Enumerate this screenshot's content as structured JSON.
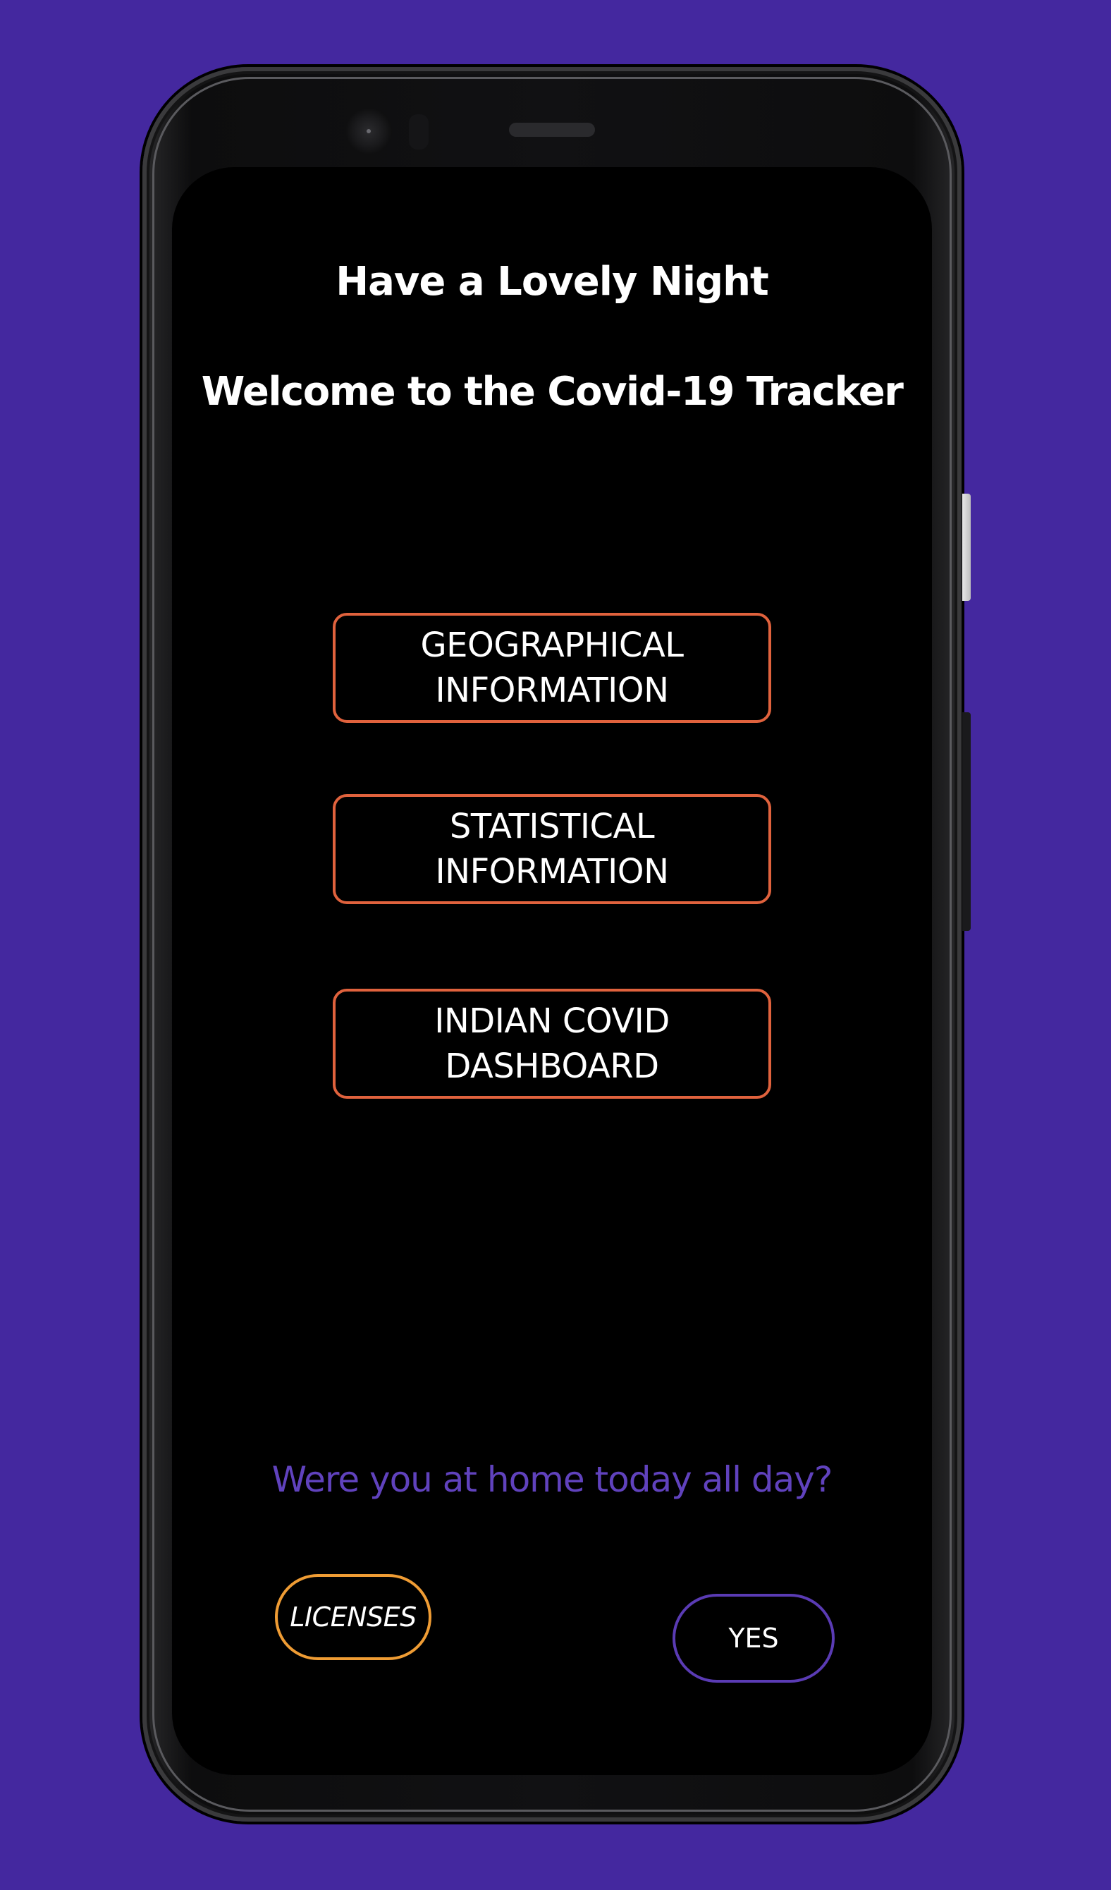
{
  "screen": {
    "greeting": "Have a Lovely Night",
    "welcome": "Welcome to the Covid-19 Tracker",
    "menu": {
      "geographical": "GEOGRAPHICAL\nINFORMATION",
      "statistical": "STATISTICAL\nINFORMATION",
      "dashboard": "INDIAN COVID\nDASHBOARD"
    },
    "question": "Were you at home today all day?",
    "licenses_label": "LICENSES",
    "yes_label": "YES"
  },
  "colors": {
    "background": "#44289f",
    "menu_border": "#e0623d",
    "question_text": "#6042bd",
    "licenses_border": "#ef9c34",
    "yes_border": "#5a3bb4"
  }
}
